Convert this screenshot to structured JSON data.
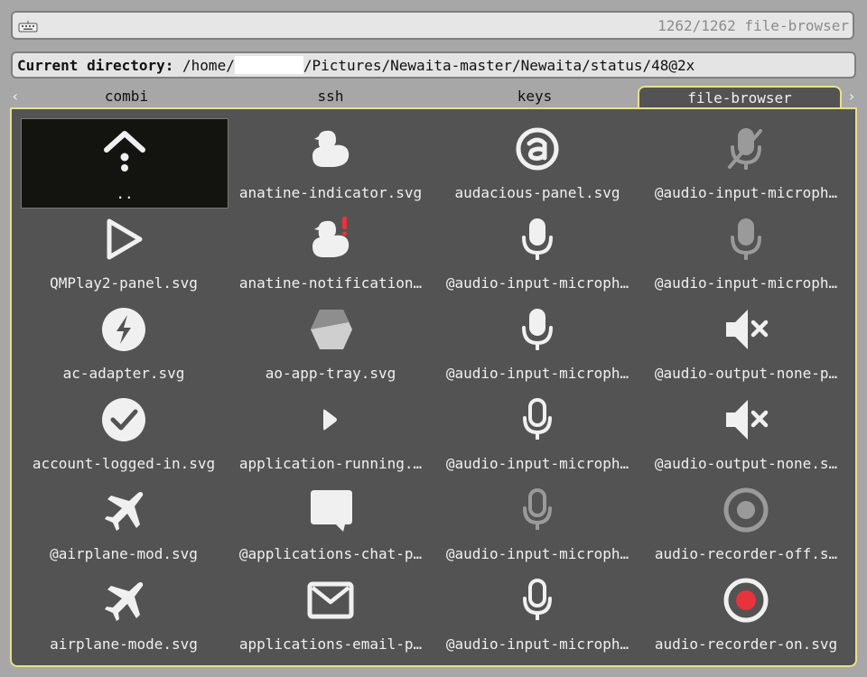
{
  "searchbar": {
    "placeholder": "",
    "counter": "1262/1262 file-browser"
  },
  "directory": {
    "label": "Current directory:",
    "path_prefix": "/home/",
    "path_suffix": "/Pictures/Newaita-master/Newaita/status/48@2x"
  },
  "tabs": [
    "combi",
    "ssh",
    "keys",
    "file-browser"
  ],
  "active_tab": "file-browser",
  "files": [
    {
      "label": "..",
      "icon": "parent-directory-icon",
      "selected": true
    },
    {
      "label": "anatine-indicator.svg",
      "icon": "duck-icon"
    },
    {
      "label": "audacious-panel.svg",
      "icon": "audacious-icon"
    },
    {
      "label": "@audio-input-microph…",
      "icon": "microphone-muted-icon"
    },
    {
      "label": "QMPlay2-panel.svg",
      "icon": "play-outline-icon"
    },
    {
      "label": "anatine-notification…",
      "icon": "duck-alert-icon"
    },
    {
      "label": "@audio-input-microph…",
      "icon": "microphone-icon"
    },
    {
      "label": "@audio-input-microph…",
      "icon": "microphone-dim-icon"
    },
    {
      "label": "ac-adapter.svg",
      "icon": "lightning-icon"
    },
    {
      "label": "ao-app-tray.svg",
      "icon": "hexagon-icon"
    },
    {
      "label": "@audio-input-microph…",
      "icon": "microphone-icon"
    },
    {
      "label": "@audio-output-none-p…",
      "icon": "speaker-mute-icon"
    },
    {
      "label": "account-logged-in.svg",
      "icon": "check-circle-icon"
    },
    {
      "label": "application-running.…",
      "icon": "small-play-icon"
    },
    {
      "label": "@audio-input-microph…",
      "icon": "microphone-outline-icon"
    },
    {
      "label": "@audio-output-none.s…",
      "icon": "speaker-mute-icon"
    },
    {
      "label": "@airplane-mod.svg",
      "icon": "airplane-icon"
    },
    {
      "label": "@applications-chat-p…",
      "icon": "chat-bubble-icon"
    },
    {
      "label": "@audio-input-microph…",
      "icon": "microphone-outline-dim-icon"
    },
    {
      "label": "audio-recorder-off.s…",
      "icon": "record-off-icon"
    },
    {
      "label": "airplane-mode.svg",
      "icon": "airplane-icon"
    },
    {
      "label": "applications-email-p…",
      "icon": "envelope-icon"
    },
    {
      "label": "@audio-input-microph…",
      "icon": "microphone-outline-icon"
    },
    {
      "label": "audio-recorder-on.svg",
      "icon": "record-on-icon"
    }
  ],
  "colors": {
    "panel": "#535353",
    "active_border": "#e8e08a",
    "record_red": "#e8333c",
    "alert_red": "#e8333c"
  }
}
